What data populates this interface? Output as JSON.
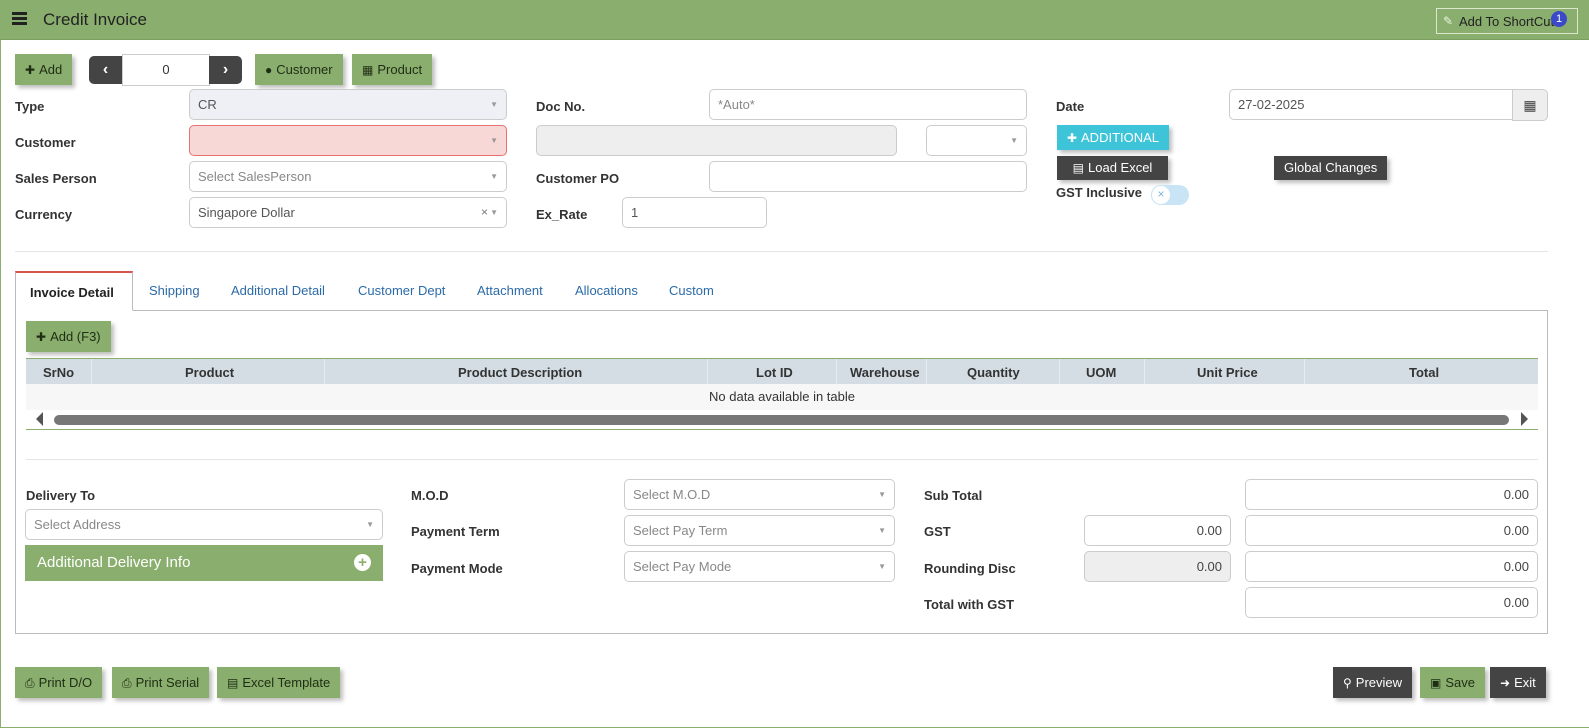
{
  "header": {
    "title": "Credit Invoice",
    "shortcut_label": "Add To ShortCut",
    "shortcut_badge": "1"
  },
  "toolbar": {
    "add_label": "Add",
    "counter_value": "0",
    "customer_label": "Customer",
    "product_label": "Product"
  },
  "form": {
    "type_label": "Type",
    "type_value": "CR",
    "customer_label": "Customer",
    "customer_value": "",
    "salesperson_label": "Sales Person",
    "salesperson_placeholder": "Select SalesPerson",
    "currency_label": "Currency",
    "currency_value": "Singapore Dollar",
    "docno_label": "Doc No.",
    "docno_placeholder": "*Auto*",
    "customer_name_value": "",
    "customer_po_label": "Customer PO",
    "customer_po_value": "",
    "exrate_label": "Ex_Rate",
    "exrate_value": "1",
    "date_label": "Date",
    "date_value": "27-02-2025",
    "additional_label": "ADDITIONAL",
    "load_excel_label": "Load Excel",
    "global_changes_label": "Global Changes",
    "gst_inclusive_label": "GST Inclusive",
    "gst_inclusive_on": false
  },
  "tabs": [
    "Invoice Detail",
    "Shipping",
    "Additional Detail",
    "Customer Dept",
    "Attachment",
    "Allocations",
    "Custom"
  ],
  "grid": {
    "add_label": "Add (F3)",
    "columns": [
      "SrNo",
      "Product",
      "Product Description",
      "Lot ID",
      "Warehouse",
      "Quantity",
      "UOM",
      "Unit Price",
      "Total"
    ],
    "empty_message": "No data available in table"
  },
  "footer_form": {
    "delivery_to_label": "Delivery To",
    "delivery_placeholder": "Select Address",
    "additional_delivery_label": "Additional Delivery Info",
    "mod_label": "M.O.D",
    "mod_placeholder": "Select M.O.D",
    "payment_term_label": "Payment Term",
    "payment_term_placeholder": "Select Pay Term",
    "payment_mode_label": "Payment Mode",
    "payment_mode_placeholder": "Select Pay Mode",
    "subtotal_label": "Sub Total",
    "subtotal_value": "0.00",
    "gst_label": "GST",
    "gst_rate_value": "0.00",
    "gst_value": "0.00",
    "rounding_label": "Rounding Disc",
    "rounding_rate_value": "0.00",
    "rounding_value": "0.00",
    "total_gst_label": "Total with GST",
    "total_gst_value": "0.00"
  },
  "actions": {
    "print_do": "Print D/O",
    "print_serial": "Print Serial",
    "excel_template": "Excel Template",
    "preview": "Preview",
    "save": "Save",
    "exit": "Exit"
  },
  "colors": {
    "brand_green": "#8aae6e",
    "dark_button": "#444444",
    "cyan_button": "#3dc4d8",
    "error_field": "#f8d7d7"
  }
}
